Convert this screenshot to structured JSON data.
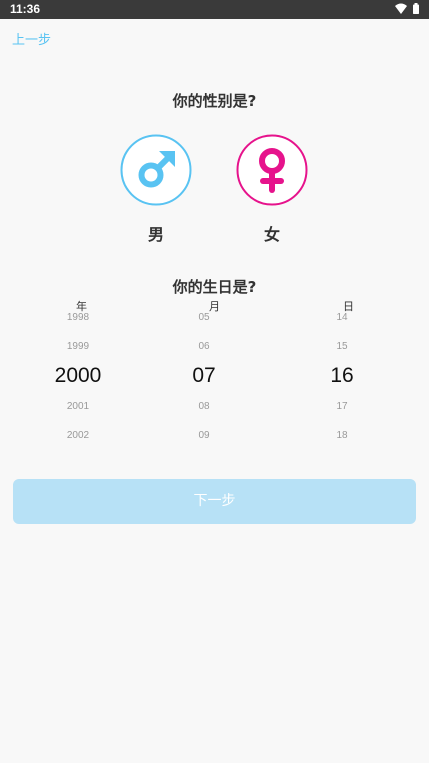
{
  "status_bar": {
    "time": "11:36",
    "icons": [
      "wifi-icon",
      "battery-icon"
    ]
  },
  "nav": {
    "back_label": "上一步"
  },
  "gender": {
    "title": "你的性别是?",
    "options": [
      {
        "label": "男",
        "icon": "male-symbol-icon",
        "color": "#59c3f2"
      },
      {
        "label": "女",
        "icon": "female-symbol-icon",
        "color": "#e6138c"
      }
    ]
  },
  "birthday": {
    "title": "你的生日是?",
    "columns": [
      {
        "header": "年",
        "items": [
          "1998",
          "1999",
          "2000",
          "2001",
          "2002"
        ],
        "selected": "2000"
      },
      {
        "header": "月",
        "items": [
          "05",
          "06",
          "07",
          "08",
          "09"
        ],
        "selected": "07"
      },
      {
        "header": "日",
        "items": [
          "14",
          "15",
          "16",
          "17",
          "18"
        ],
        "selected": "16"
      }
    ]
  },
  "next_button": {
    "label": "下一步",
    "color": "#b7e1f6"
  },
  "colors": {
    "accent": "#59c3f2",
    "female": "#e6138c",
    "background": "#f8f8f8"
  }
}
